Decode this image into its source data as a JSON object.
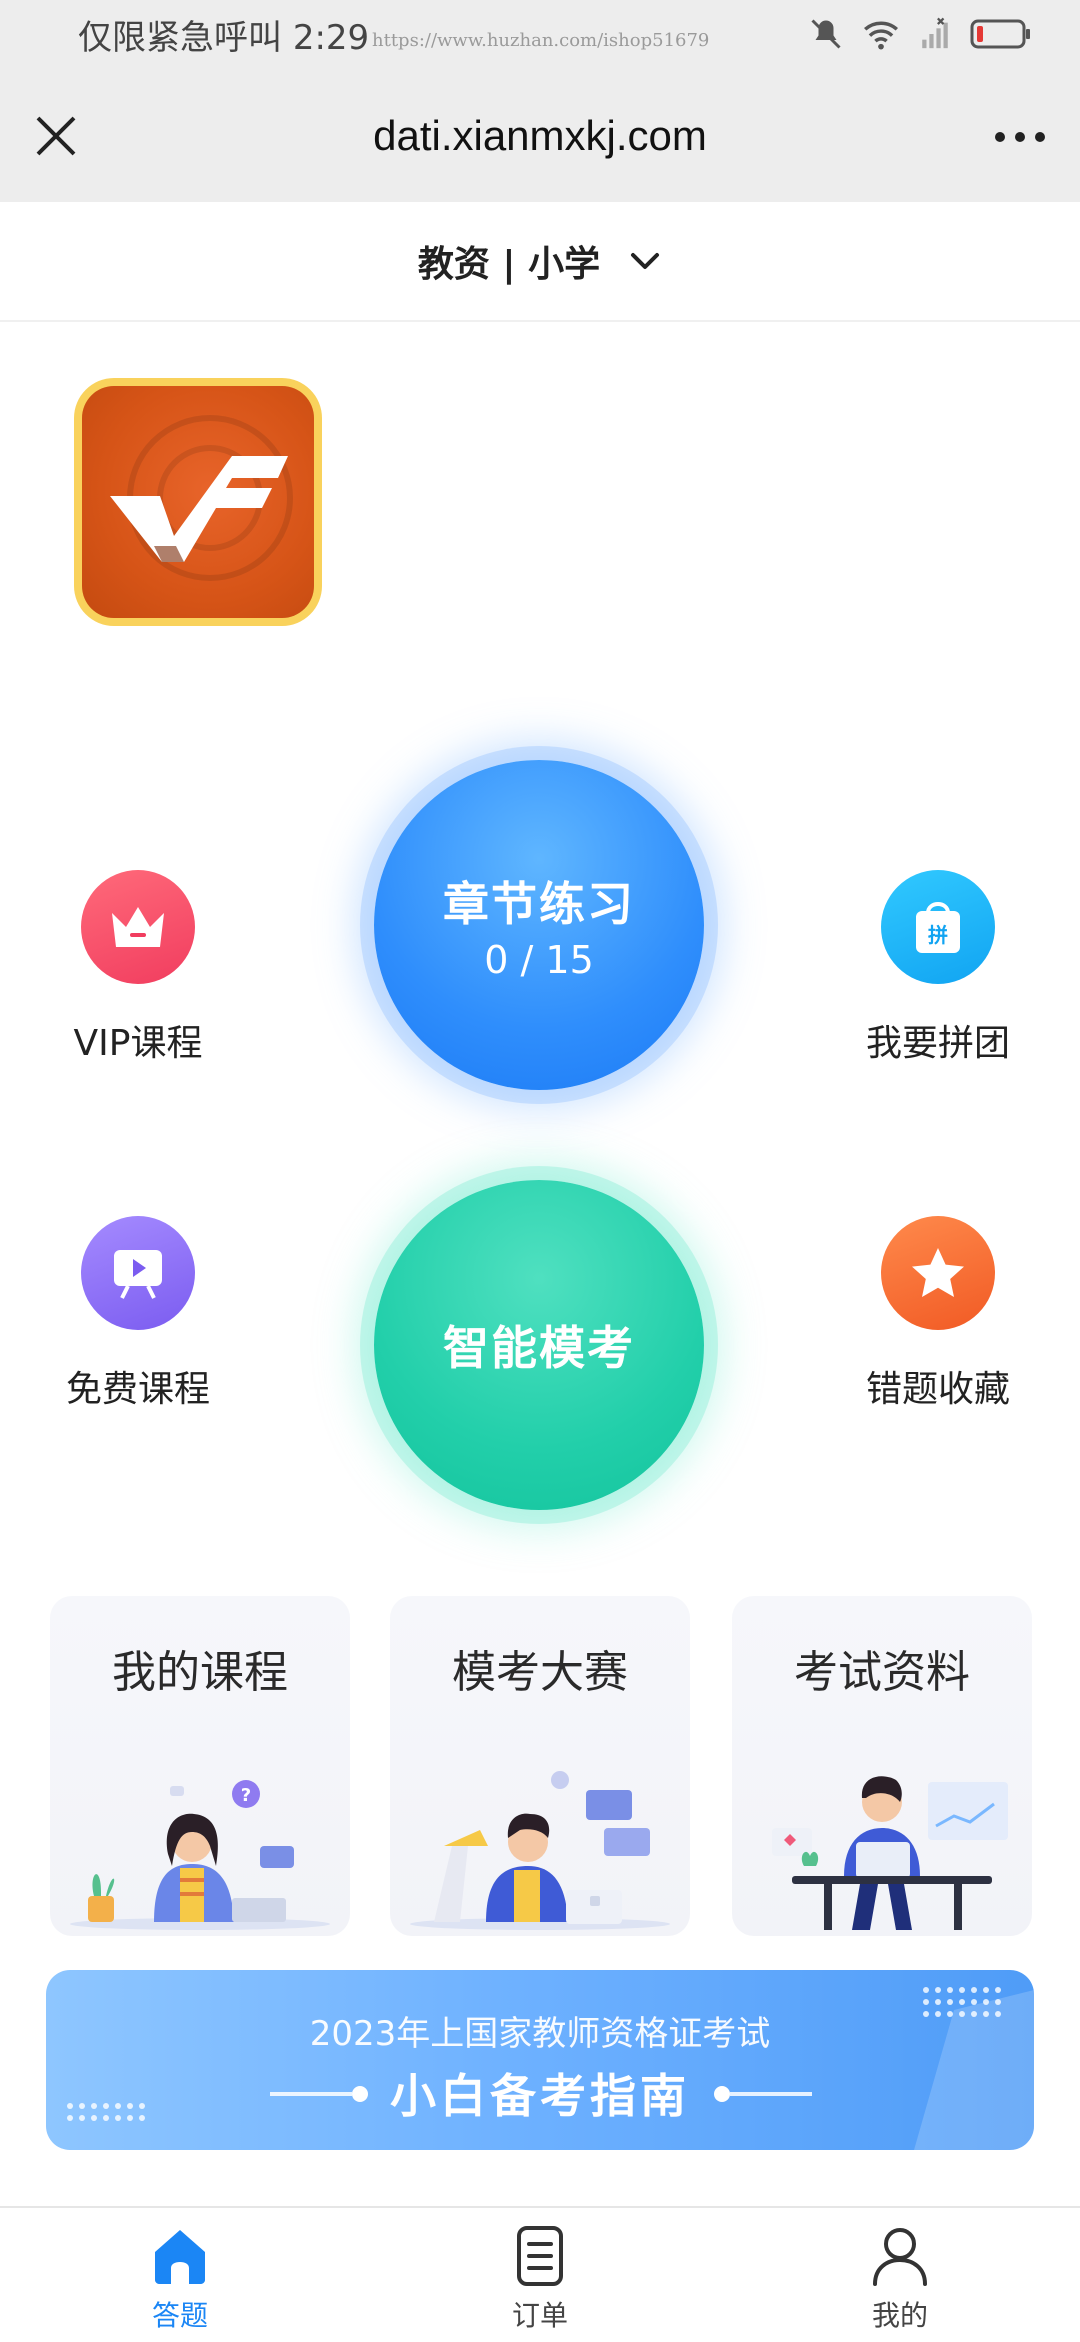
{
  "status_bar": {
    "carrier_text": "仅限紧急呼叫",
    "time": "2:29",
    "url_overlay": "https://www.huzhan.com/ishop51679"
  },
  "browser": {
    "title": "dati.xianmxkj.com"
  },
  "selector": {
    "label": "教资 | 小学"
  },
  "main_actions": {
    "practice_title": "章节练习",
    "practice_progress": "0 / 15",
    "mock_title": "智能模考"
  },
  "quick_links": {
    "vip": "VIP课程",
    "group": "我要拼团",
    "free": "免费课程",
    "wrong": "错题收藏"
  },
  "cards": {
    "my_course": "我的课程",
    "mock_contest": "模考大赛",
    "exam_materials": "考试资料"
  },
  "banner": {
    "subtitle": "2023年上国家教师资格证考试",
    "title": "小白备考指南"
  },
  "tabbar": {
    "tabs": [
      {
        "label": "答题",
        "active": true
      },
      {
        "label": "订单",
        "active": false
      },
      {
        "label": "我的",
        "active": false
      }
    ]
  },
  "colors": {
    "accent_blue": "#1b86f5",
    "mock_green": "#13c39c",
    "header_bg": "#ededed"
  }
}
